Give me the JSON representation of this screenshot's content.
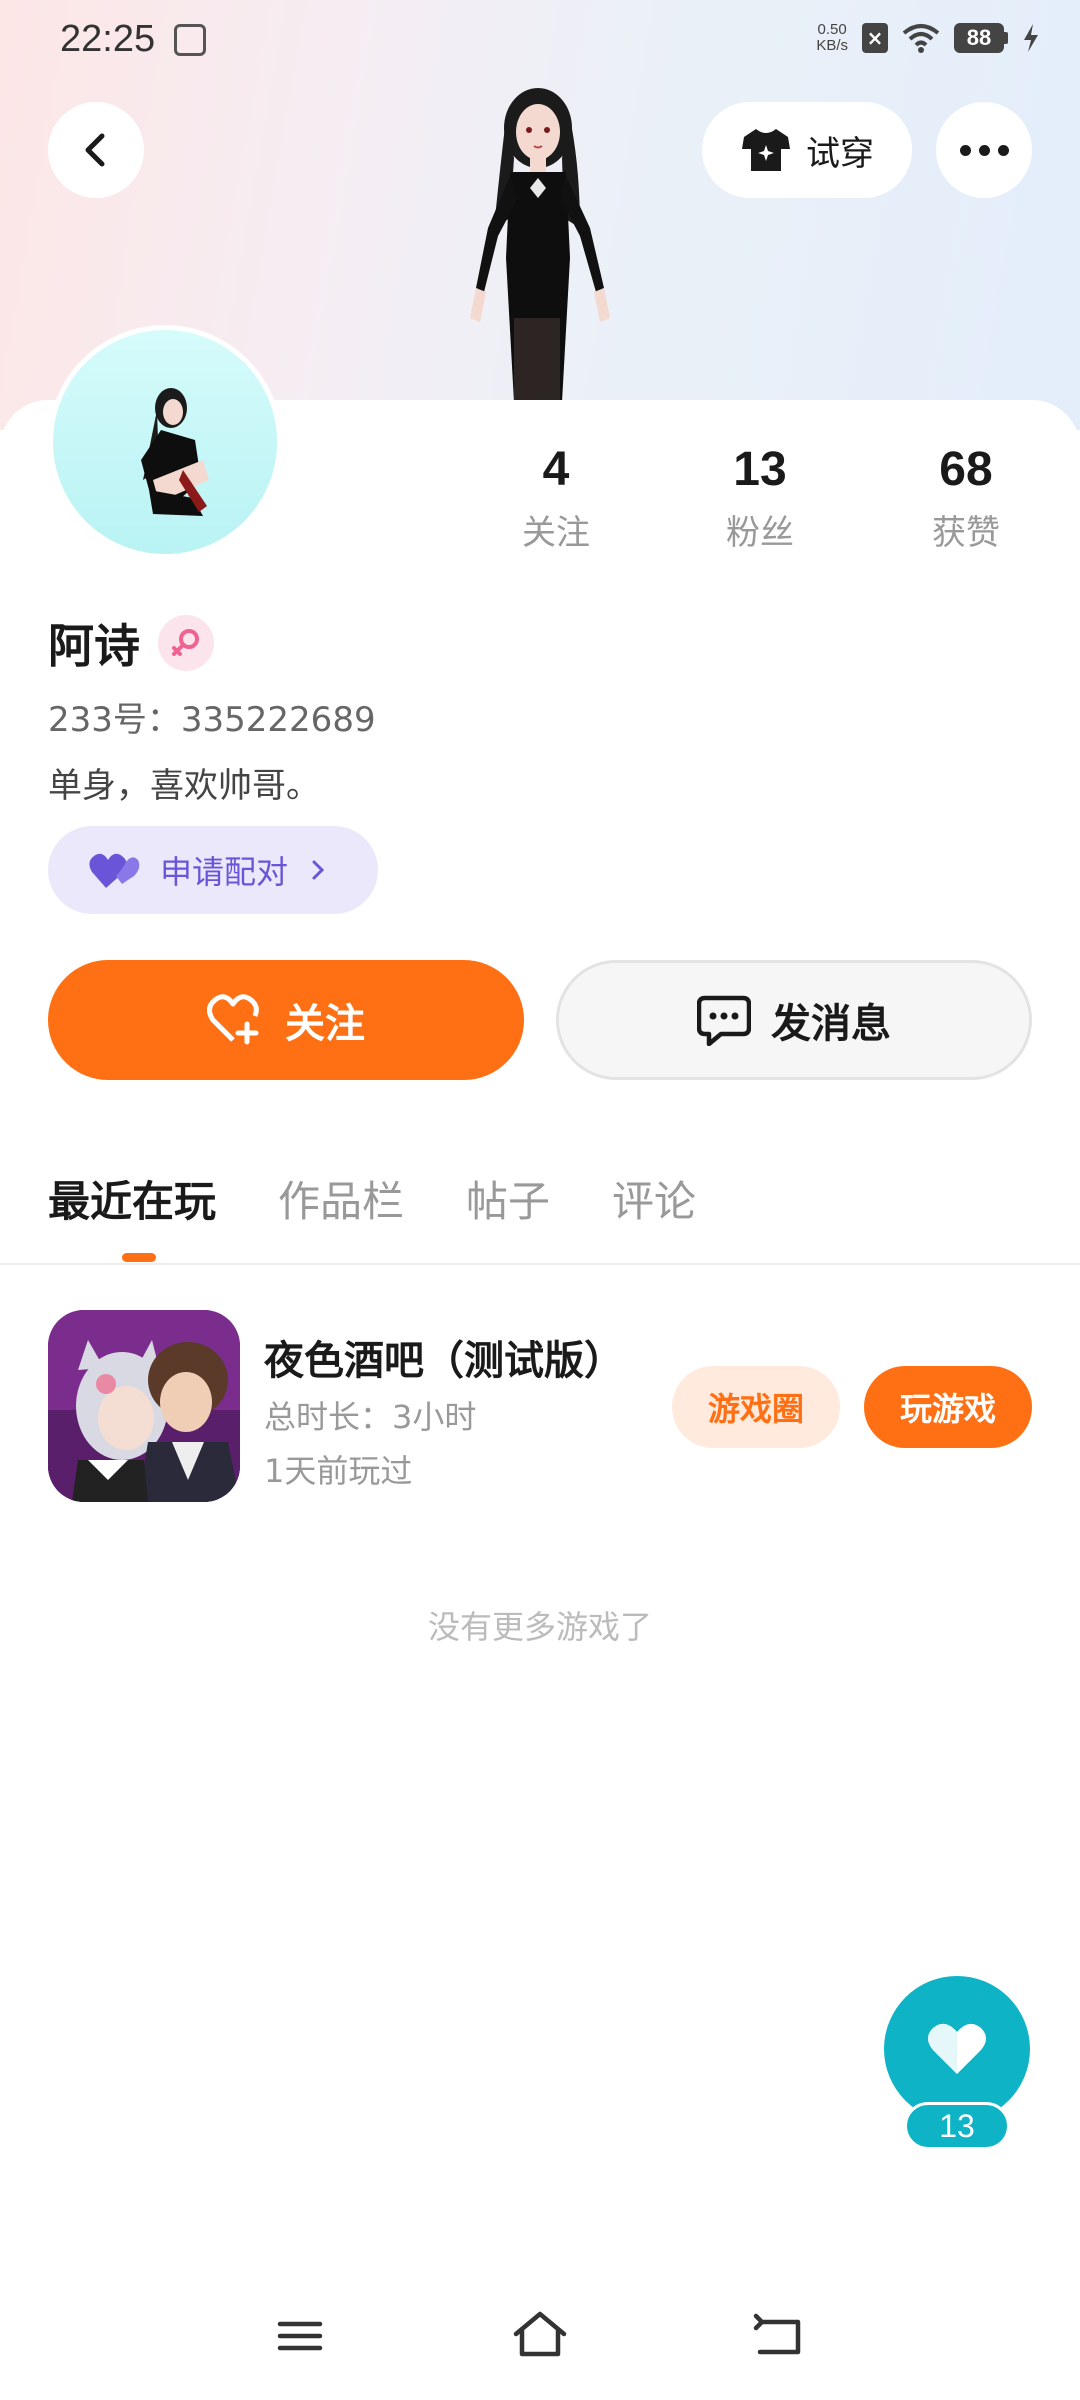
{
  "status_bar": {
    "time": "22:25",
    "net_speed_value": "0.50",
    "net_speed_unit": "KB/s",
    "battery": "88"
  },
  "header": {
    "tryon_label": "试穿"
  },
  "stats": [
    {
      "value": "4",
      "label": "关注"
    },
    {
      "value": "13",
      "label": "粉丝"
    },
    {
      "value": "68",
      "label": "获赞"
    }
  ],
  "profile": {
    "name": "阿诗",
    "uid": "233号：335222689",
    "bio": "单身，喜欢帅哥。",
    "pair_label": "申请配对"
  },
  "actions": {
    "follow_label": "关注",
    "message_label": "发消息"
  },
  "tabs": [
    {
      "label": "最近在玩",
      "active": true
    },
    {
      "label": "作品栏",
      "active": false
    },
    {
      "label": "帖子",
      "active": false
    },
    {
      "label": "评论",
      "active": false
    }
  ],
  "games": [
    {
      "title": "夜色酒吧（测试版）",
      "duration": "总时长：3小时",
      "last_played": "1天前玩过",
      "circle_label": "游戏圈",
      "play_label": "玩游戏"
    }
  ],
  "footer_note": "没有更多游戏了",
  "like_fab": {
    "count": "13"
  },
  "colors": {
    "accent": "#ff7014",
    "pair": "#6a55d8",
    "like": "#0eb4c6"
  }
}
